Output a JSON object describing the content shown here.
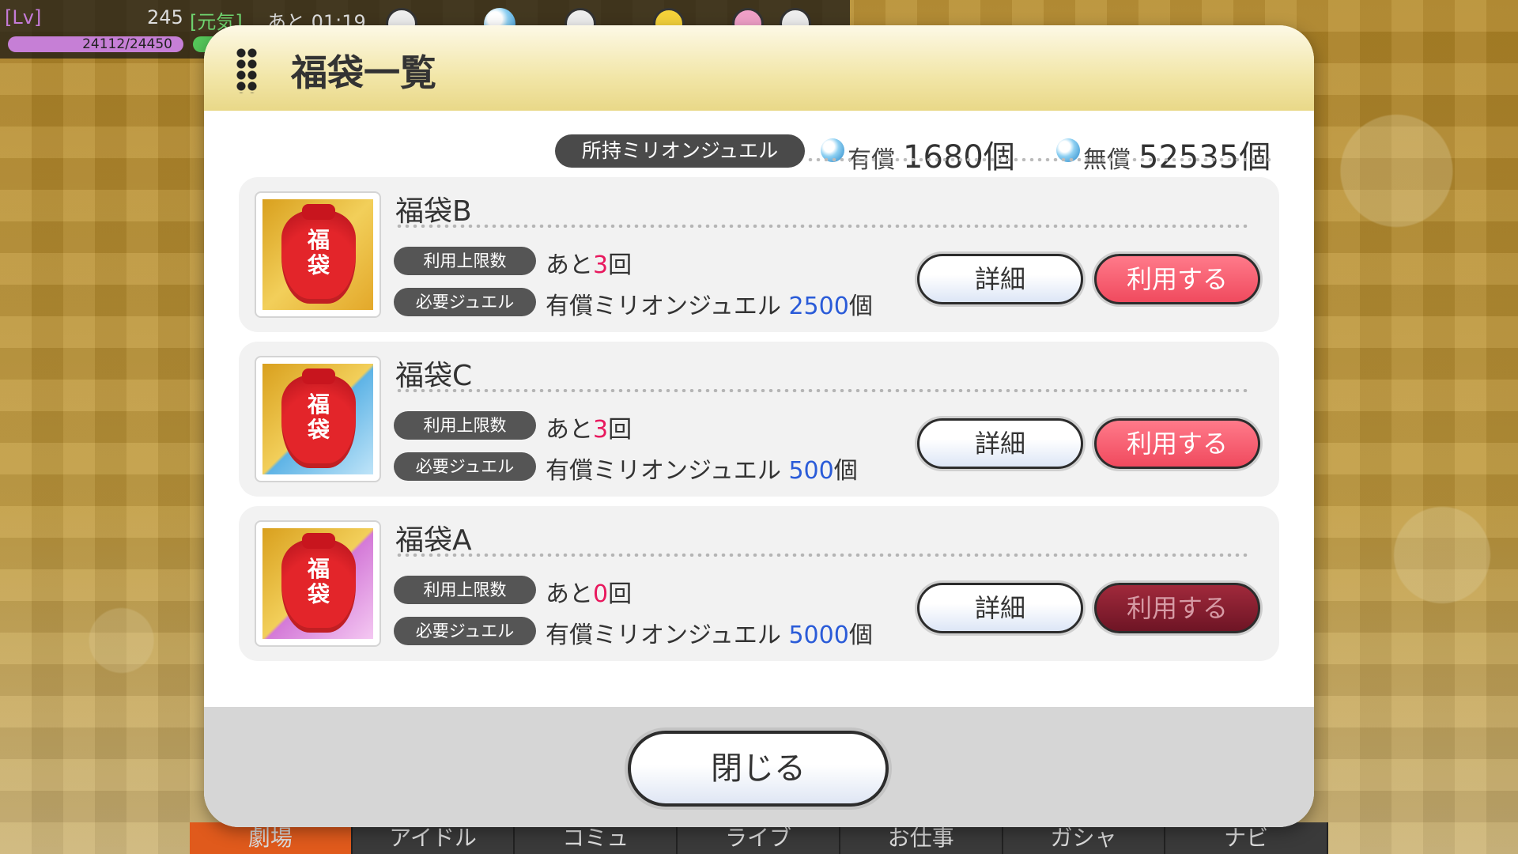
{
  "status": {
    "lv_label": "[Lv]",
    "lv_value": "245",
    "genki_label": "[元気]",
    "genki_time": "あと 01:19",
    "exp": "24112/24450"
  },
  "bottom_nav": [
    "劇場",
    "アイドル",
    "コミュ",
    "ライブ",
    "お仕事",
    "ガシャ",
    "ナビ"
  ],
  "dialog": {
    "title": "福袋一覧",
    "jewels": {
      "label": "所持ミリオンジュエル",
      "paid_label": "有償",
      "paid_amount": "1680個",
      "free_label": "無償",
      "free_amount": "52535個"
    },
    "limit_label": "利用上限数",
    "jewel_label": "必要ジュエル",
    "remaining_prefix": "あと",
    "remaining_suffix": "回",
    "jewel_type_text": "有償ミリオンジュエル",
    "jewel_unit": "個",
    "detail_label": "詳細",
    "use_label": "利用する",
    "bag_kanji": "福袋",
    "bags": [
      {
        "name": "福袋B",
        "remaining": "3",
        "cost": "2500",
        "enabled": true
      },
      {
        "name": "福袋C",
        "remaining": "3",
        "cost": "500",
        "enabled": true
      },
      {
        "name": "福袋A",
        "remaining": "0",
        "cost": "5000",
        "enabled": false
      }
    ],
    "close_label": "閉じる"
  },
  "colors": {
    "use_button": "#f04a5e",
    "use_button_disabled": "#6e1525",
    "highlight_count": "#e8195e",
    "highlight_cost": "#2a5bd8",
    "header_gold": "#f2e6a8"
  }
}
